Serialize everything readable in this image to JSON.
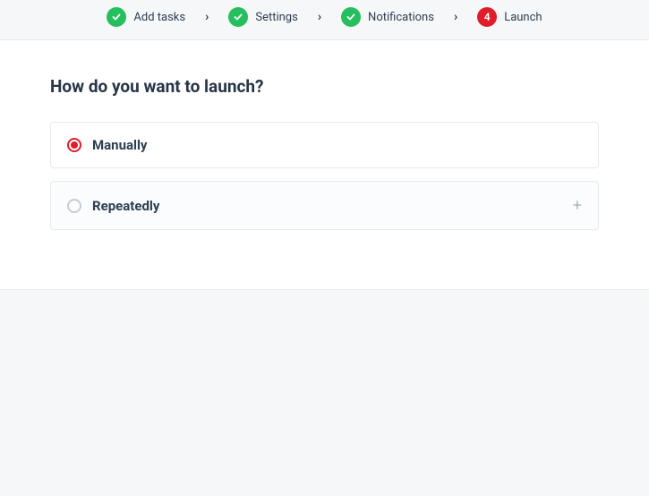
{
  "stepper": {
    "steps": [
      {
        "label": "Add tasks",
        "status": "complete"
      },
      {
        "label": "Settings",
        "status": "complete"
      },
      {
        "label": "Notifications",
        "status": "complete"
      },
      {
        "label": "Launch",
        "status": "current",
        "number": "4"
      }
    ]
  },
  "main": {
    "title": "How do you want to launch?",
    "options": [
      {
        "label": "Manually",
        "selected": true,
        "expandable": false
      },
      {
        "label": "Repeatedly",
        "selected": false,
        "expandable": true
      }
    ]
  }
}
